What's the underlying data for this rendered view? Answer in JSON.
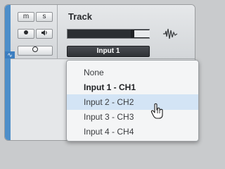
{
  "track": {
    "name": "Track",
    "mute_label": "m",
    "solo_label": "s",
    "record_icon": "record-dot-icon",
    "monitor_icon": "speaker-icon",
    "option_icon": "circle-icon",
    "meter_fill_fraction": 0.78,
    "waveform_icon": "waveform-icon",
    "input_selected": "Input 1"
  },
  "menu": {
    "items": [
      {
        "label": "None"
      },
      {
        "label": "Input 1 - CH1"
      },
      {
        "label": "Input 2 - CH2"
      },
      {
        "label": "Input 3 - CH3"
      },
      {
        "label": "Input 4 - CH4"
      }
    ]
  },
  "colors": {
    "accent_blue": "#4d8ec9",
    "hover": "#d3e4f5"
  }
}
